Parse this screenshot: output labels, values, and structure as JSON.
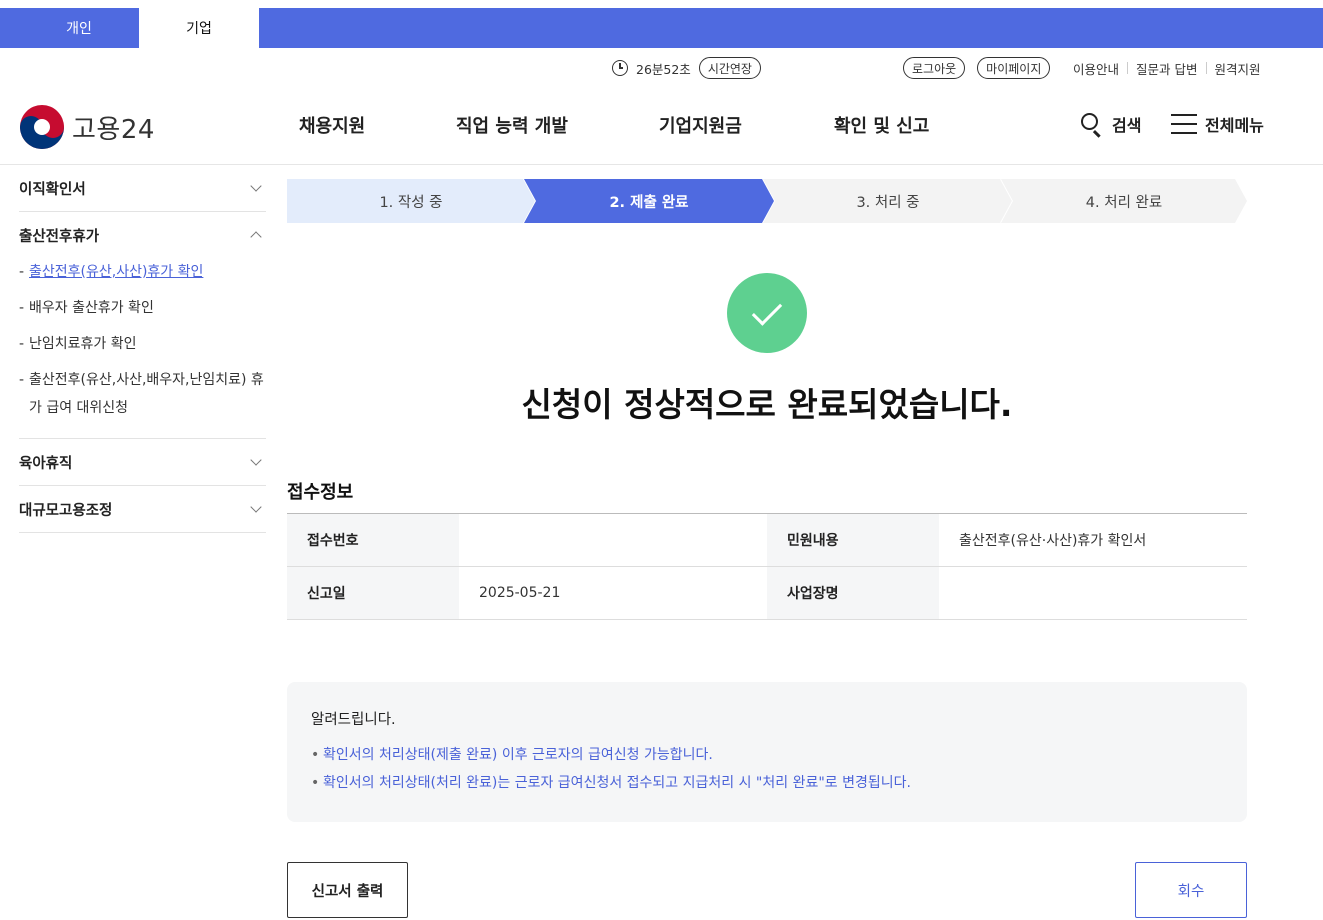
{
  "top_tabs": {
    "personal": "개인",
    "company": "기업"
  },
  "utility": {
    "timer": "26분52초",
    "extend_label": "시간연장",
    "logout_label": "로그아웃",
    "mypage_label": "마이페이지",
    "links": [
      "이용안내",
      "질문과 답변",
      "원격지원"
    ]
  },
  "header": {
    "logo_text": "고용24",
    "nav": [
      "채용지원",
      "직업 능력 개발",
      "기업지원금",
      "확인 및 신고"
    ],
    "search_label": "검색",
    "menu_label": "전체메뉴"
  },
  "sidebar": {
    "groups": [
      {
        "title": "이직확인서"
      },
      {
        "title": "출산전후휴가",
        "items": [
          "출산전후(유산,사산)휴가 확인",
          "배우자 출산휴가 확인",
          "난임치료휴가 확인",
          "출산전후(유산,사산,배우자,난임치료) 휴가 급여 대위신청"
        ]
      },
      {
        "title": "육아휴직"
      },
      {
        "title": "대규모고용조정"
      }
    ]
  },
  "steps": [
    "1. 작성 중",
    "2. 제출 완료",
    "3. 처리 중",
    "4. 처리 완료"
  ],
  "success_message": "신청이 정상적으로 완료되었습니다.",
  "receipt": {
    "title": "접수정보",
    "receipt_no_label": "접수번호",
    "receipt_no_value": "",
    "petition_label": "민원내용",
    "petition_value": "출산전후(유산·사산)휴가 확인서",
    "report_date_label": "신고일",
    "report_date_value": "2025-05-21",
    "workplace_label": "사업장명",
    "workplace_value": ""
  },
  "notice": {
    "title": "알려드립니다.",
    "items": [
      "확인서의 처리상태(제출 완료) 이후 근로자의 급여신청 가능합니다.",
      "확인서의 처리상태(처리 완료)는 근로자 급여신청서 접수되고 지급처리 시 \"처리 완료\"로 변경됩니다."
    ]
  },
  "buttons": {
    "print": "신고서 출력",
    "withdraw": "회수"
  },
  "colors": {
    "accent": "#4f6ae0",
    "success": "#5ed090",
    "step_done": "#e3ecfb",
    "step_future": "#f3f3f3"
  }
}
